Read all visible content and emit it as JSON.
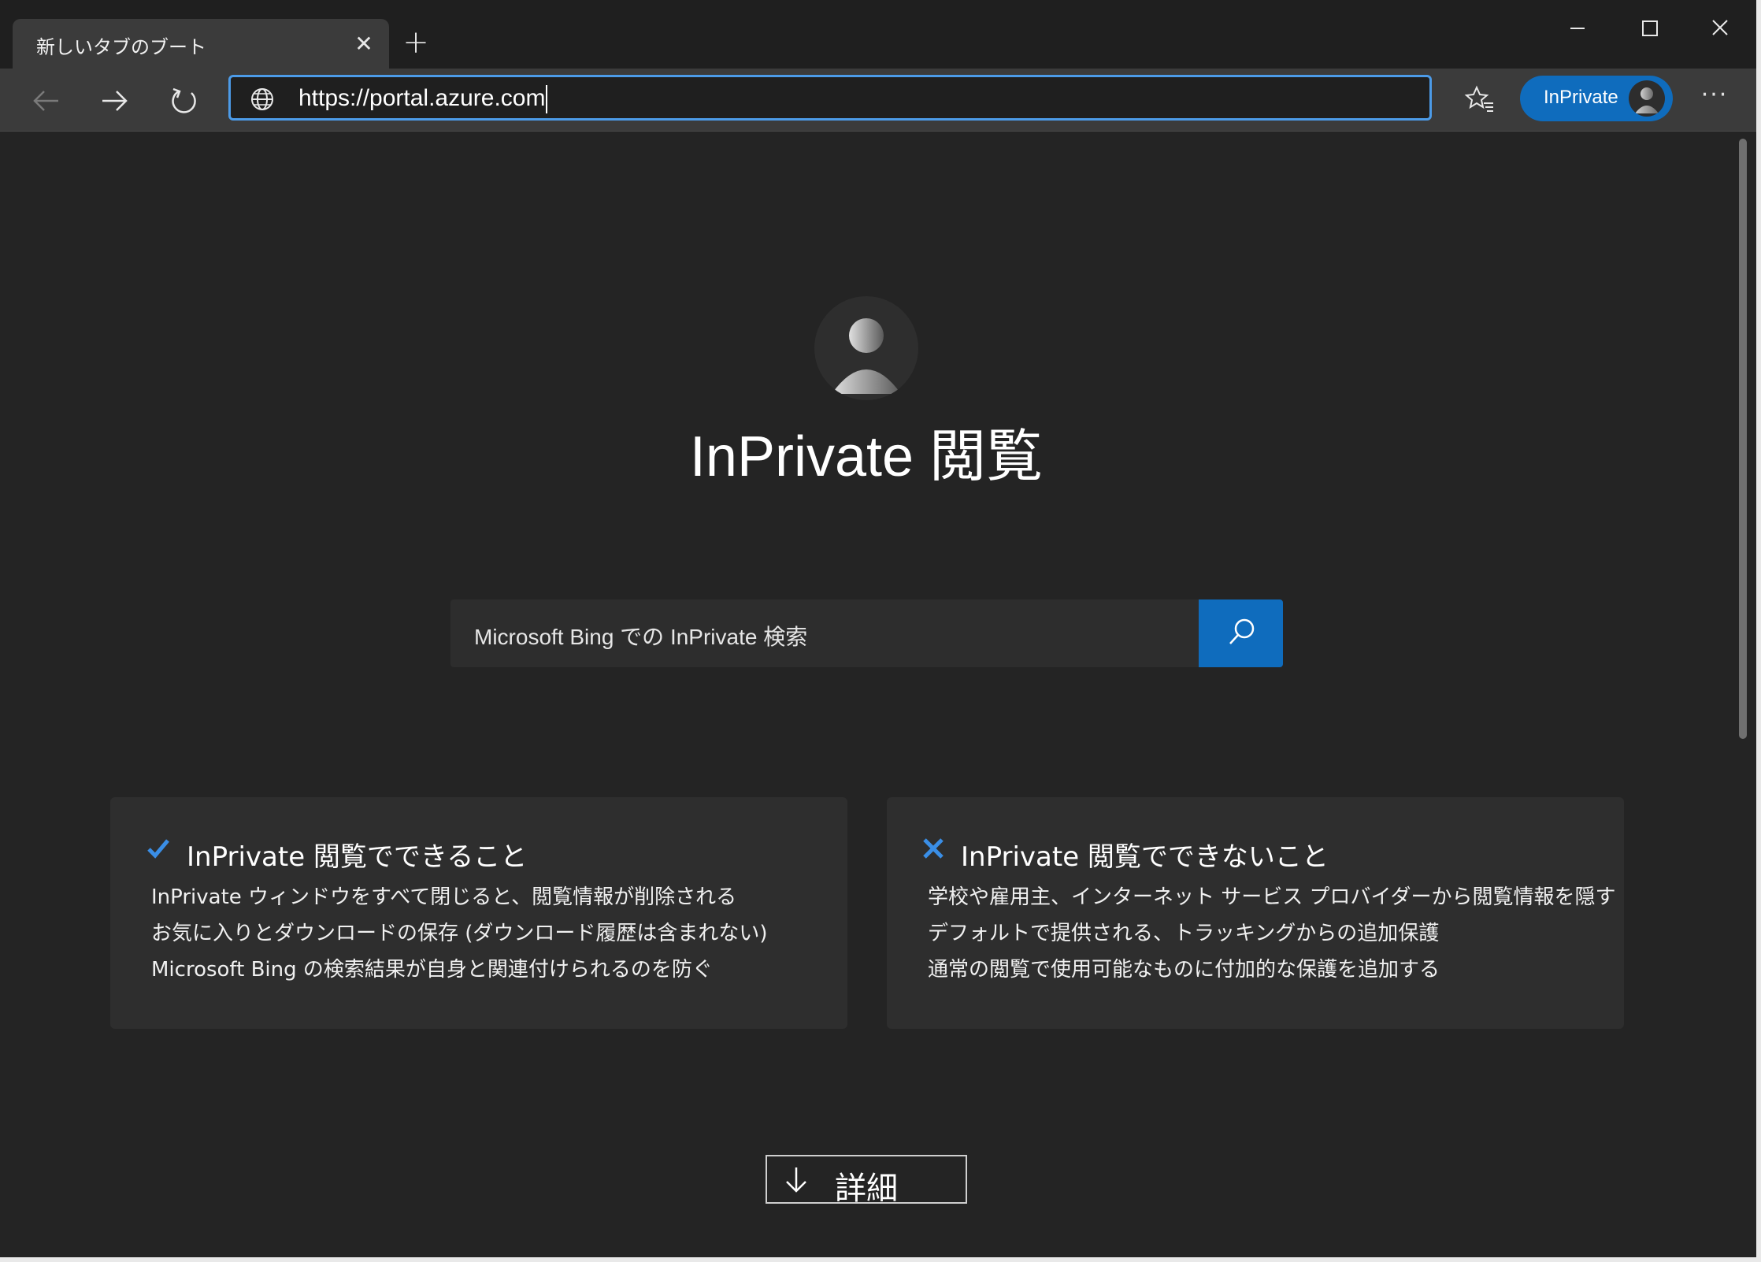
{
  "tab": {
    "title": "新しいタブのブート",
    "close_icon": "close-icon"
  },
  "window_controls": {
    "minimize_icon": "minimize-icon",
    "maximize_icon": "maximize-icon",
    "close_icon": "close-icon"
  },
  "toolbar": {
    "back_icon": "arrow-left-icon",
    "forward_icon": "arrow-right-icon",
    "refresh_icon": "refresh-icon",
    "address": {
      "site_icon": "globe-icon",
      "url": "https://portal.azure.com"
    },
    "favorites_icon": "favorites-star-icon",
    "inprivate_label": "InPrivate",
    "more_label": "···"
  },
  "page": {
    "title": "InPrivate 閲覧",
    "search": {
      "placeholder": "Microsoft  Bing での InPrivate 検索",
      "button_icon": "search-icon"
    },
    "can_do": {
      "heading": "InPrivate 閲覧でできること",
      "items": [
        "InPrivate ウィンドウをすべて閉じると、閲覧情報が削除される",
        "お気に入りとダウンロードの保存 (ダウンロード履歴は含まれない)",
        "Microsoft Bing の検索結果が自身と関連付けられるのを防ぐ"
      ]
    },
    "cannot_do": {
      "heading": "InPrivate 閲覧でできないこと",
      "items": [
        "学校や雇用主、インターネット サービス プロバイダーから閲覧情報を隠す",
        "デフォルトで提供される、トラッキングからの追加保護",
        "通常の閲覧で使用可能なものに付加的な保護を追加する"
      ]
    },
    "details_label": "詳細"
  },
  "colors": {
    "accent": "#0f6cbd",
    "address_focus": "#4c9be8",
    "page_bg": "#242424",
    "card_bg": "#2e2e2e",
    "check": "#3a8ee6"
  }
}
